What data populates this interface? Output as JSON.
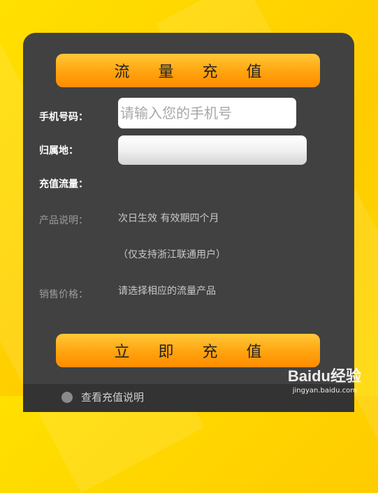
{
  "header": {
    "title": "流 量 充 值"
  },
  "form": {
    "phone_label": "手机号码：",
    "phone_placeholder": "请输入您的手机号",
    "region_label": "归属地：",
    "traffic_label": "充值流量：",
    "desc_label": "产品说明：",
    "desc_line1": "次日生效  有效期四个月",
    "desc_line2": "（仅支持浙江联通用户）",
    "price_label": "销售价格：",
    "price_value": "请选择相应的流量产品"
  },
  "actions": {
    "submit_label": "立 即 充 值"
  },
  "footer": {
    "help_link": "查看充值说明"
  },
  "watermark": {
    "brand": "Baidu经验",
    "url": "jingyan.baidu.com"
  },
  "colors": {
    "accent": "#ffa30e",
    "card": "#414141",
    "background": "#ffd400"
  }
}
